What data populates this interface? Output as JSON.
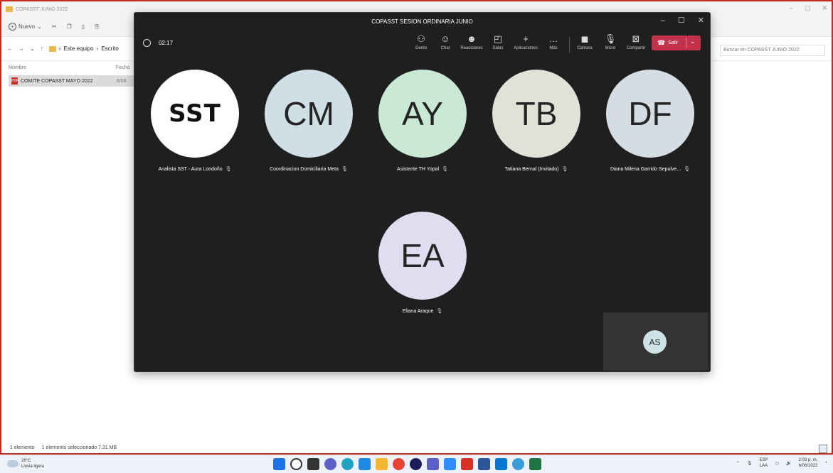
{
  "explorer": {
    "title": "COPASST JUNIO 2022",
    "toolbar": {
      "new_label": "Nuevo"
    },
    "address": {
      "crumb1": "Este equipo",
      "crumb2": "Escrito"
    },
    "search_placeholder": "Buscar en COPASST JUNIO 2022",
    "columns": {
      "name": "Nombre",
      "date": "Fecha"
    },
    "file": {
      "name": "COMITE COPASST MAYO 2022",
      "date": "6/06"
    },
    "status": {
      "count": "1 elemento",
      "selected": "1 elemento seleccionado  7,31 MB"
    }
  },
  "teams": {
    "title": "COPASST SESION ORDINARIA JUNIO",
    "timer": "02:17",
    "toolbar": {
      "people": "Gente",
      "chat": "Chat",
      "reactions": "Reacciones",
      "rooms": "Salas",
      "apps": "Aplicaciones",
      "more": "Más",
      "camera": "Cámara",
      "mic": "Micro",
      "share": "Compartir",
      "leave": "Salir"
    },
    "participants": [
      {
        "initials": "SST",
        "name": "Analista SST - Aura Londoño",
        "color": "#ffffff"
      },
      {
        "initials": "CM",
        "name": "Coordinacion Domiciliaria Meta",
        "color": "#d0dfe6"
      },
      {
        "initials": "AY",
        "name": "Asistente TH Yopal",
        "color": "#c9e9d4"
      },
      {
        "initials": "TB",
        "name": "Tatiana Bernal (Invitado)",
        "color": "#dfe2d6"
      },
      {
        "initials": "DF",
        "name": "Diana Milena Garrido Sepulve...",
        "color": "#d6dde2"
      },
      {
        "initials": "EA",
        "name": "Eliana Araque",
        "color": "#e0ddf0"
      }
    ],
    "self": {
      "initials": "AS"
    }
  },
  "taskbar": {
    "weather": {
      "temp": "26°C",
      "desc": "Lluvia ligera"
    },
    "lang": {
      "primary": "ESP",
      "secondary": "LAA"
    },
    "clock": {
      "time": "2:03 p. m.",
      "date": "6/06/2022"
    },
    "apps": [
      "start",
      "search",
      "taskview",
      "chat",
      "edge",
      "store",
      "files",
      "chrome",
      "opera",
      "teams",
      "zoom",
      "acrobat",
      "word",
      "photos",
      "snip",
      "excel"
    ]
  }
}
